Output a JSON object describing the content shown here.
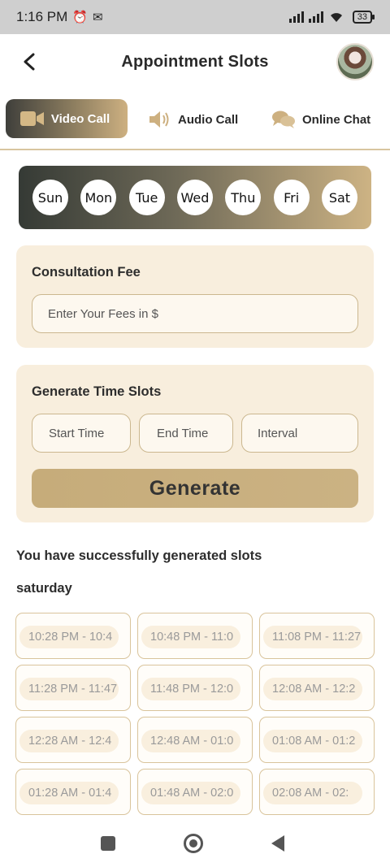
{
  "status_bar": {
    "time": "1:16 PM",
    "battery": "33"
  },
  "header": {
    "title": "Appointment Slots"
  },
  "tabs": [
    {
      "label": "Video Call",
      "icon": "video-camera-icon"
    },
    {
      "label": "Audio Call",
      "icon": "speaker-icon"
    },
    {
      "label": "Online Chat",
      "icon": "chat-bubbles-icon"
    }
  ],
  "days": [
    "Sun",
    "Mon",
    "Tue",
    "Wed",
    "Thu",
    "Fri",
    "Sat"
  ],
  "consultation": {
    "title": "Consultation Fee",
    "fee_placeholder": "Enter Your Fees in $"
  },
  "time_slots": {
    "title": "Generate Time Slots",
    "start_placeholder": "Start Time",
    "end_placeholder": "End Time",
    "interval_placeholder": "Interval",
    "generate_label": "Generate"
  },
  "result": {
    "message": "You have successfully generated slots",
    "day": "saturday",
    "slots": [
      "10:28 PM - 10:4",
      "10:48 PM - 11:0",
      "11:08 PM - 11:27",
      "11:28 PM - 11:47",
      "11:48 PM - 12:0",
      "12:08 AM - 12:2",
      "12:28 AM - 12:4",
      "12:48 AM - 01:0",
      "01:08 AM - 01:2",
      "01:28 AM - 01:4",
      "01:48 AM - 02:0",
      "02:08 AM - 02:"
    ]
  },
  "colors": {
    "accent": "#c9ae7e",
    "card_bg": "#f8eedd",
    "dark": "#3f3f3b"
  }
}
